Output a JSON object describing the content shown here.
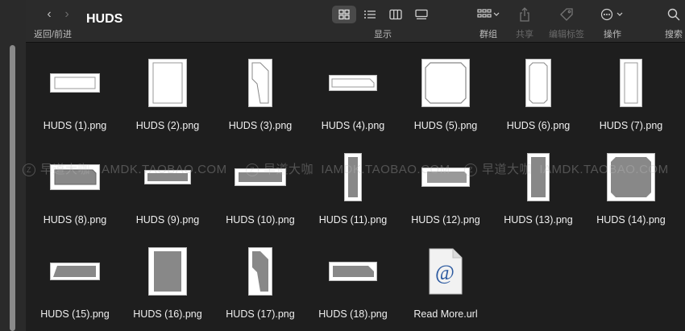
{
  "toolbar": {
    "title": "HUDS",
    "back_label": "返回/前进",
    "view_label": "显示",
    "group_label": "群组",
    "share_label": "共享",
    "tags_label": "编辑标签",
    "action_label": "操作",
    "search_label": "搜索",
    "views": [
      "icon-view",
      "list-view",
      "column-view",
      "gallery-view"
    ],
    "active_view": "icon-view"
  },
  "watermark": {
    "brand": "早道大咖",
    "site": "IAMDK.TAOBAO.COM"
  },
  "files": [
    {
      "name": "HUDS (1).png"
    },
    {
      "name": "HUDS (2).png"
    },
    {
      "name": "HUDS (3).png"
    },
    {
      "name": "HUDS (4).png"
    },
    {
      "name": "HUDS (5).png"
    },
    {
      "name": "HUDS (6).png"
    },
    {
      "name": "HUDS (7).png"
    },
    {
      "name": "HUDS (8).png"
    },
    {
      "name": "HUDS (9).png"
    },
    {
      "name": "HUDS (10).png"
    },
    {
      "name": "HUDS (11).png"
    },
    {
      "name": "HUDS (12).png"
    },
    {
      "name": "HUDS (13).png"
    },
    {
      "name": "HUDS (14).png"
    },
    {
      "name": "HUDS (15).png"
    },
    {
      "name": "HUDS (16).png"
    },
    {
      "name": "HUDS (17).png"
    },
    {
      "name": "HUDS (18).png"
    },
    {
      "name": "Read More.url"
    }
  ]
}
